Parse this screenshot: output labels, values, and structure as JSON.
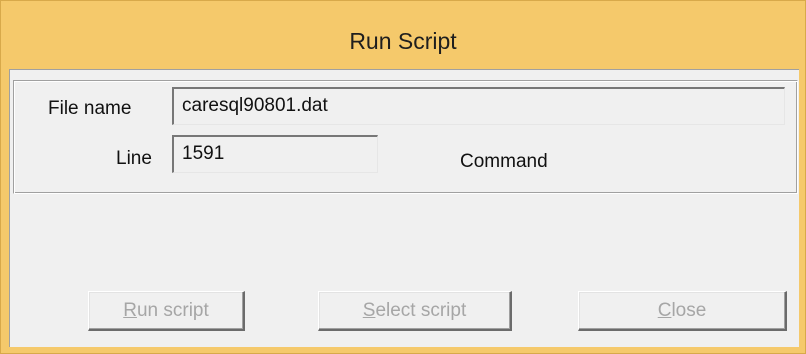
{
  "window": {
    "title": "Run Script"
  },
  "form": {
    "file_name_label": "File name",
    "file_name_value": "caresql90801.dat",
    "line_label": "Line",
    "line_value": "1591",
    "command_label": "Command"
  },
  "buttons": {
    "run": {
      "mnemonic": "R",
      "rest": "un script"
    },
    "select": {
      "mnemonic": "S",
      "rest": "elect script"
    },
    "close": {
      "mnemonic": "C",
      "rest": "lose"
    }
  },
  "colors": {
    "titlebar": "#f5c96b",
    "client": "#f0f0f0",
    "disabled_text": "#a6a6a6"
  }
}
